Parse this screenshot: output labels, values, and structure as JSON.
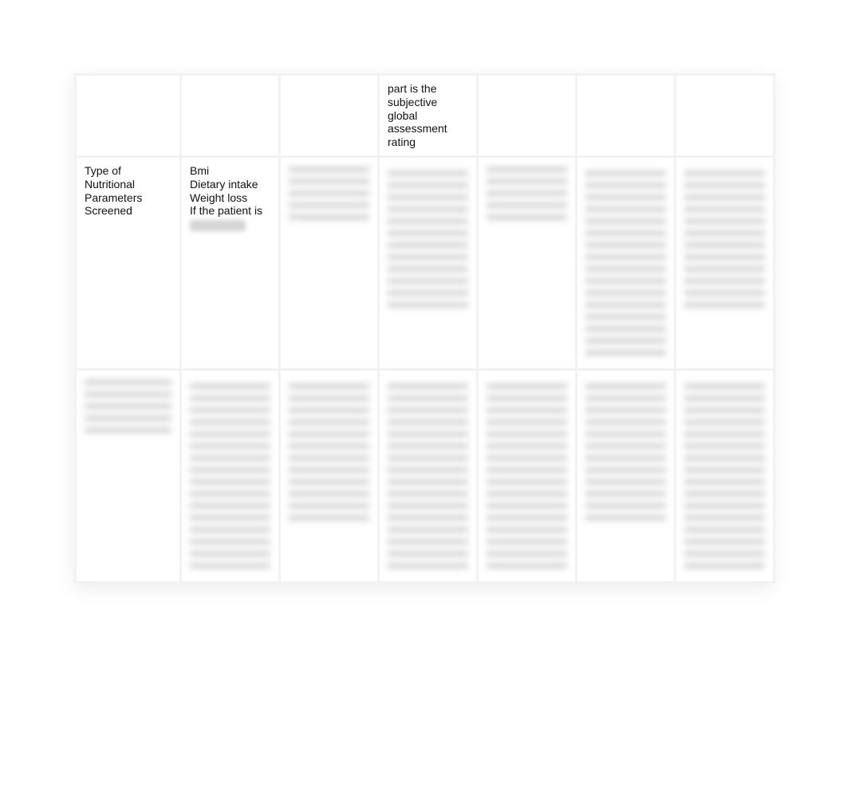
{
  "table": {
    "rows": [
      {
        "cells": [
          {
            "text": "",
            "blur": false
          },
          {
            "text": "",
            "blur": false
          },
          {
            "text": "",
            "blur": false
          },
          {
            "text": "part is the subjective global assessment rating",
            "blur": false
          },
          {
            "text": "",
            "blur": false
          },
          {
            "text": "",
            "blur": false
          },
          {
            "text": "",
            "blur": false
          }
        ]
      },
      {
        "cells": [
          {
            "text": "Type of Nutritional Parameters Screened",
            "blur": false
          },
          {
            "lines": [
              "Bmi",
              "Dietary intake",
              "Weight loss",
              "If the patient is"
            ],
            "blur": false,
            "tailBlur": true
          },
          {
            "blur": true,
            "size": "short"
          },
          {
            "blur": true,
            "size": "mid"
          },
          {
            "blur": true,
            "size": "short"
          },
          {
            "blur": true,
            "size": "tall"
          },
          {
            "blur": true,
            "size": "mid"
          }
        ]
      },
      {
        "cells": [
          {
            "blur": true,
            "size": "short"
          },
          {
            "blur": true,
            "size": "tall"
          },
          {
            "blur": true,
            "size": "mid"
          },
          {
            "blur": true,
            "size": "tall"
          },
          {
            "blur": true,
            "size": "tall"
          },
          {
            "blur": true,
            "size": "mid"
          },
          {
            "blur": true,
            "size": "tall"
          }
        ]
      }
    ]
  }
}
